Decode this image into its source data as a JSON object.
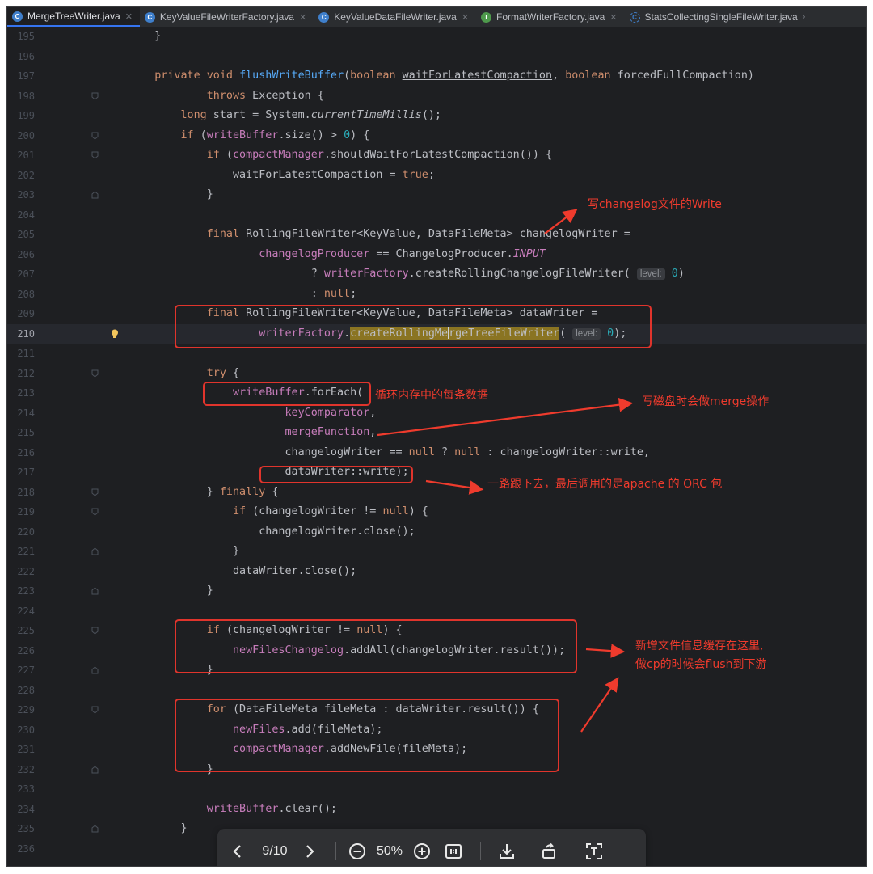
{
  "tabs": [
    {
      "label": "MergeTreeWriter.java",
      "icon": "class-icon",
      "active": true
    },
    {
      "label": "KeyValueFileWriterFactory.java",
      "icon": "class-icon",
      "active": false
    },
    {
      "label": "KeyValueDataFileWriter.java",
      "icon": "class-icon",
      "active": false
    },
    {
      "label": "FormatWriterFactory.java",
      "icon": "interface-icon",
      "active": false
    },
    {
      "label": "StatsCollectingSingleFileWriter.java",
      "icon": "abstract-class-icon",
      "active": false
    }
  ],
  "code_lines": [
    {
      "n": "195",
      "text": "    }"
    },
    {
      "n": "196",
      "text": ""
    },
    {
      "n": "197",
      "text": "    private void flushWriteBuffer(boolean waitForLatestCompaction, boolean forcedFullCompaction)"
    },
    {
      "n": "198",
      "text": "            throws Exception {"
    },
    {
      "n": "199",
      "text": "        long start = System.currentTimeMillis();"
    },
    {
      "n": "200",
      "text": "        if (writeBuffer.size() > 0) {"
    },
    {
      "n": "201",
      "text": "            if (compactManager.shouldWaitForLatestCompaction()) {"
    },
    {
      "n": "202",
      "text": "                waitForLatestCompaction = true;"
    },
    {
      "n": "203",
      "text": "            }"
    },
    {
      "n": "204",
      "text": ""
    },
    {
      "n": "205",
      "text": "            final RollingFileWriter<KeyValue, DataFileMeta> changelogWriter ="
    },
    {
      "n": "206",
      "text": "                    changelogProducer == ChangelogProducer.INPUT"
    },
    {
      "n": "207",
      "text": "                            ? writerFactory.createRollingChangelogFileWriter( level: 0)"
    },
    {
      "n": "208",
      "text": "                            : null;"
    },
    {
      "n": "209",
      "text": "            final RollingFileWriter<KeyValue, DataFileMeta> dataWriter ="
    },
    {
      "n": "210",
      "text": "                    writerFactory.createRollingMergeTreeFileWriter( level: 0);"
    },
    {
      "n": "211",
      "text": ""
    },
    {
      "n": "212",
      "text": "            try {"
    },
    {
      "n": "213",
      "text": "                writeBuffer.forEach("
    },
    {
      "n": "214",
      "text": "                        keyComparator,"
    },
    {
      "n": "215",
      "text": "                        mergeFunction,"
    },
    {
      "n": "216",
      "text": "                        changelogWriter == null ? null : changelogWriter::write,"
    },
    {
      "n": "217",
      "text": "                        dataWriter::write);"
    },
    {
      "n": "218",
      "text": "            } finally {"
    },
    {
      "n": "219",
      "text": "                if (changelogWriter != null) {"
    },
    {
      "n": "220",
      "text": "                    changelogWriter.close();"
    },
    {
      "n": "221",
      "text": "                }"
    },
    {
      "n": "222",
      "text": "                dataWriter.close();"
    },
    {
      "n": "223",
      "text": "            }"
    },
    {
      "n": "224",
      "text": ""
    },
    {
      "n": "225",
      "text": "            if (changelogWriter != null) {"
    },
    {
      "n": "226",
      "text": "                newFilesChangelog.addAll(changelogWriter.result());"
    },
    {
      "n": "227",
      "text": "            }"
    },
    {
      "n": "228",
      "text": ""
    },
    {
      "n": "229",
      "text": "            for (DataFileMeta fileMeta : dataWriter.result()) {"
    },
    {
      "n": "230",
      "text": "                newFiles.add(fileMeta);"
    },
    {
      "n": "231",
      "text": "                compactManager.addNewFile(fileMeta);"
    },
    {
      "n": "232",
      "text": "            }"
    },
    {
      "n": "233",
      "text": ""
    },
    {
      "n": "234",
      "text": "            writeBuffer.clear();"
    },
    {
      "n": "235",
      "text": "        }"
    },
    {
      "n": "236",
      "text": ""
    }
  ],
  "current_line": "210",
  "annotations": {
    "changelog_writer": "写changelog文件的Write",
    "loop_memory": "循环内存中的每条数据",
    "merge_on_write": "写磁盘时会做merge操作",
    "orc_package": "一路跟下去，最后调用的是apache 的 ORC 包",
    "new_files_cache_line1": "新增文件信息缓存在这里,",
    "new_files_cache_line2": "做cp的时候会flush到下游"
  },
  "viewer": {
    "page": "9/10",
    "zoom": "50%",
    "prev_icon": "chevron-left-icon",
    "next_icon": "chevron-right-icon",
    "zoom_out_icon": "zoom-out-icon",
    "zoom_in_icon": "zoom-in-icon",
    "actual_size_icon": "actual-size-icon",
    "download_icon": "download-icon",
    "rotate_icon": "rotate-icon",
    "ocr_icon": "text-recognition-icon"
  },
  "colors": {
    "background": "#1e1f22",
    "keyword": "#cf8e6d",
    "method": "#56a8f5",
    "field": "#c77dbb",
    "number": "#2aacb8",
    "annotation": "#ef3b2d",
    "search_highlight": "#8a7422"
  }
}
